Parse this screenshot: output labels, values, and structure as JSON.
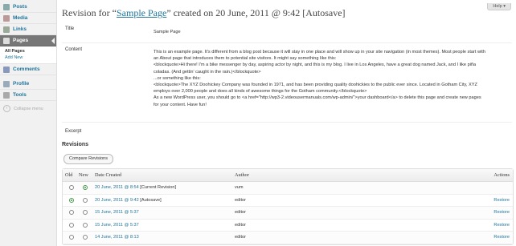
{
  "sidebar": {
    "items": [
      {
        "label": "Posts",
        "color": "#8aa"
      },
      {
        "label": "Media",
        "color": "#b99"
      },
      {
        "label": "Links",
        "color": "#9a9"
      },
      {
        "label": "Pages",
        "color": "#ccc"
      },
      {
        "label": "Comments",
        "color": "#89b"
      },
      {
        "label": "Profile",
        "color": "#9ab"
      },
      {
        "label": "Tools",
        "color": "#aaa"
      }
    ],
    "submenu": [
      "All Pages",
      "Add New"
    ],
    "collapse_label": "Collapse menu"
  },
  "header": {
    "help_label": "Help ▾",
    "title_prefix": "Revision for “",
    "title_link": "Sample Page",
    "title_suffix": "” created on 20 June, 2011 @ 9:42 [Autosave]"
  },
  "revision": {
    "fields": [
      {
        "label": "Title",
        "value": "Sample Page"
      },
      {
        "label": "Content",
        "lines": [
          "This is an example page. It's different from a blog post because it will stay in one place and will show up in your site navigation (in most themes). Most people start with",
          "an About page that introduces them to potential site visitors. It might say something like this:",
          "<blockquote>Hi there! I'm a bike messenger by day, aspiring actor by night, and this is my blog. I live in Los Angeles, have a great dog named Jack, and I like piña",
          "coladas. (And gettin' caught in the rain.)</blockquote>",
          "...or something like this:",
          "<blockquote>The XYZ Doohickey Company was founded in 1971, and has been providing quality doohickies to the public ever since. Located in Gotham City, XYZ",
          "employs over 2,000 people and does all kinds of awesome things for the Gotham community.</blockquote>",
          "As a new WordPress user, you should go to <a href=\"http://wp3-2.videousermanuals.com/wp-admin/\">your dashboard</a> to delete this page and create new pages",
          "for your content. Have fun!"
        ]
      },
      {
        "label": "Excerpt",
        "value": ""
      }
    ]
  },
  "revisions": {
    "heading": "Revisions",
    "compare_button": "Compare Revisions",
    "columns": {
      "old": "Old",
      "new": "New",
      "date": "Date Created",
      "author": "Author",
      "actions": "Actions"
    },
    "rows": [
      {
        "date": "20 June, 2011 @ 8:54",
        "note": "[Current Revision]",
        "author": "vum",
        "action": "",
        "old": false,
        "new": true
      },
      {
        "date": "20 June, 2011 @ 9:42",
        "note": "[Autosave]",
        "author": "editor",
        "action": "Restore",
        "old": true,
        "new": false
      },
      {
        "date": "15 June, 2011 @ 5:37",
        "note": "",
        "author": "editor",
        "action": "Restore",
        "old": false,
        "new": false
      },
      {
        "date": "15 June, 2011 @ 5:37",
        "note": "",
        "author": "editor",
        "action": "Restore",
        "old": false,
        "new": false
      },
      {
        "date": "14 June, 2011 @ 8:13",
        "note": "",
        "author": "editor",
        "action": "Restore",
        "old": false,
        "new": false
      }
    ]
  }
}
